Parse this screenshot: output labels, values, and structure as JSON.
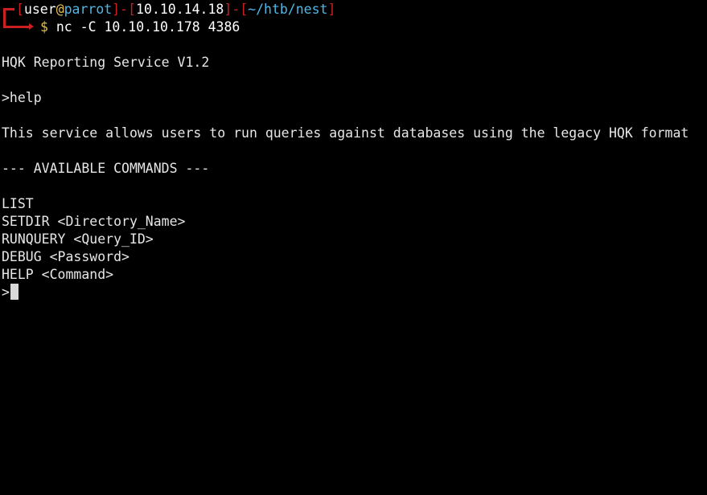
{
  "prompt": {
    "bracket_open": "[",
    "user": "user",
    "at": "@",
    "host": "parrot",
    "bracket_close": "]",
    "dash": "-",
    "ip": "10.10.14.18",
    "path": "~/htb/nest",
    "symbol": "$",
    "command": "nc -C 10.10.10.178 4386"
  },
  "output": {
    "banner": "HQK Reporting Service V1.2",
    "input_help": ">help",
    "description": "This service allows users to run queries against databases using the legacy HQK format",
    "commands_header": "--- AVAILABLE COMMANDS ---",
    "commands": [
      "LIST",
      "SETDIR <Directory_Name>",
      "RUNQUERY <Query_ID>",
      "DEBUG <Password>",
      "HELP <Command>"
    ],
    "input_prompt": ">"
  },
  "colors": {
    "background": "#000000",
    "text": "#e6e6e6",
    "prompt_red": "#cc1f1f",
    "host_blue": "#4fb8e8",
    "symbol_yellow": "#e3c14a"
  }
}
